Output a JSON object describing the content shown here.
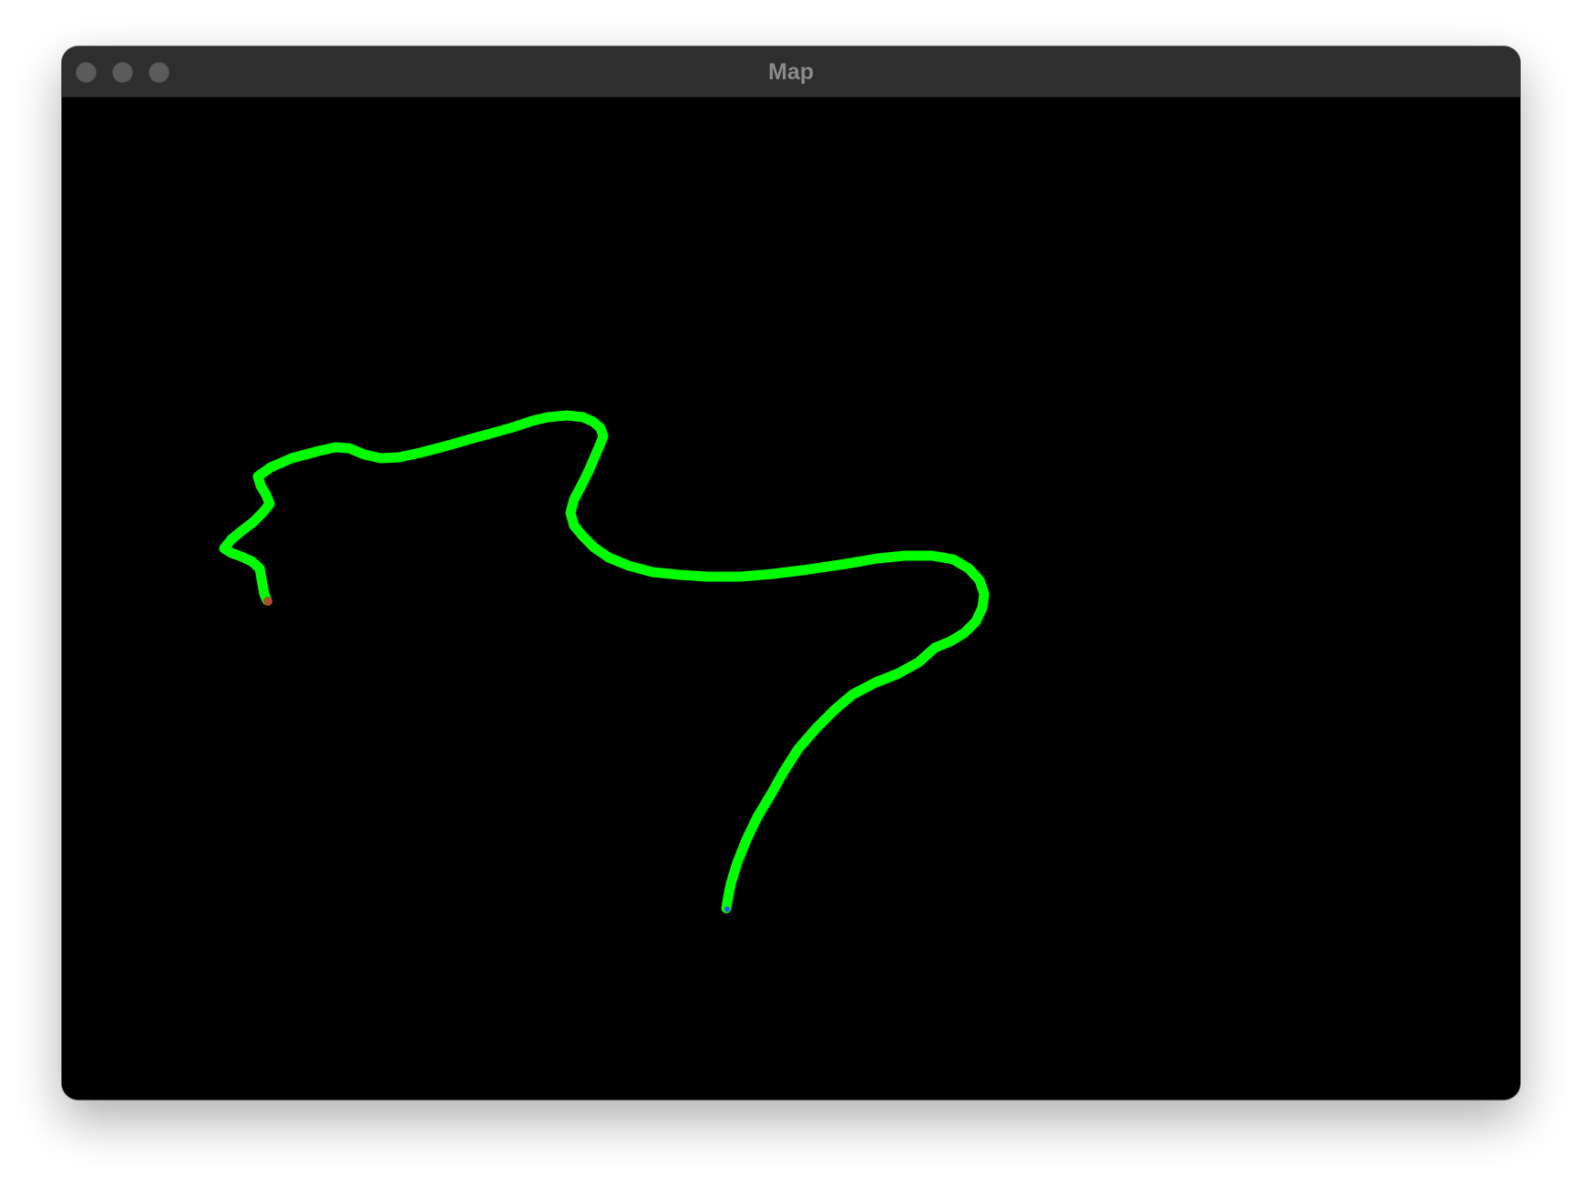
{
  "window": {
    "title": "Map"
  },
  "titlebar": {
    "buttons": [
      {
        "name": "close",
        "color": "#5b5b5b"
      },
      {
        "name": "minimize",
        "color": "#5b5b5b"
      },
      {
        "name": "zoom",
        "color": "#5b5b5b"
      }
    ]
  },
  "map": {
    "background": "#000000",
    "trajectory_color": "#00ff00",
    "start_marker_color": "#b04a2a",
    "end_marker_color": "#3050ff"
  }
}
